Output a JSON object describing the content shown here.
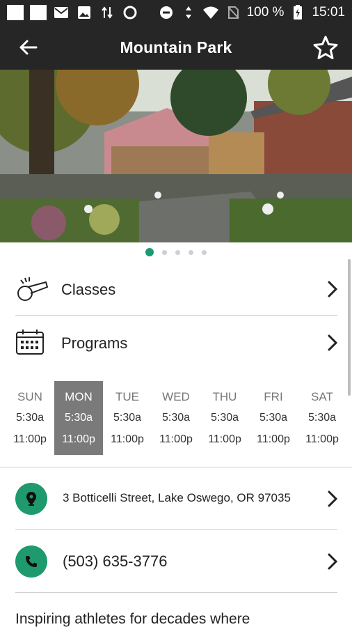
{
  "status_bar": {
    "battery": "100 %",
    "time": "15:01"
  },
  "header": {
    "title": "Mountain Park",
    "back_icon": "arrow-left-icon",
    "favorite_icon": "star-outline-icon"
  },
  "carousel": {
    "page_count": 5,
    "active_index": 0,
    "accent": "#199a6f"
  },
  "menu": {
    "classes_label": "Classes",
    "programs_label": "Programs"
  },
  "hours": {
    "days": [
      {
        "name": "SUN",
        "open": "5:30a",
        "close": "11:00p"
      },
      {
        "name": "MON",
        "open": "5:30a",
        "close": "11:00p"
      },
      {
        "name": "TUE",
        "open": "5:30a",
        "close": "11:00p"
      },
      {
        "name": "WED",
        "open": "5:30a",
        "close": "11:00p"
      },
      {
        "name": "THU",
        "open": "5:30a",
        "close": "11:00p"
      },
      {
        "name": "FRI",
        "open": "5:30a",
        "close": "11:00p"
      },
      {
        "name": "SAT",
        "open": "5:30a",
        "close": "11:00p"
      }
    ],
    "selected_day": "MON"
  },
  "contact": {
    "address": "3 Botticelli Street, Lake Oswego, OR 97035",
    "phone": "(503) 635-3776",
    "accent": "#1e9a6e"
  },
  "description": {
    "text": "Inspiring athletes for decades where"
  }
}
